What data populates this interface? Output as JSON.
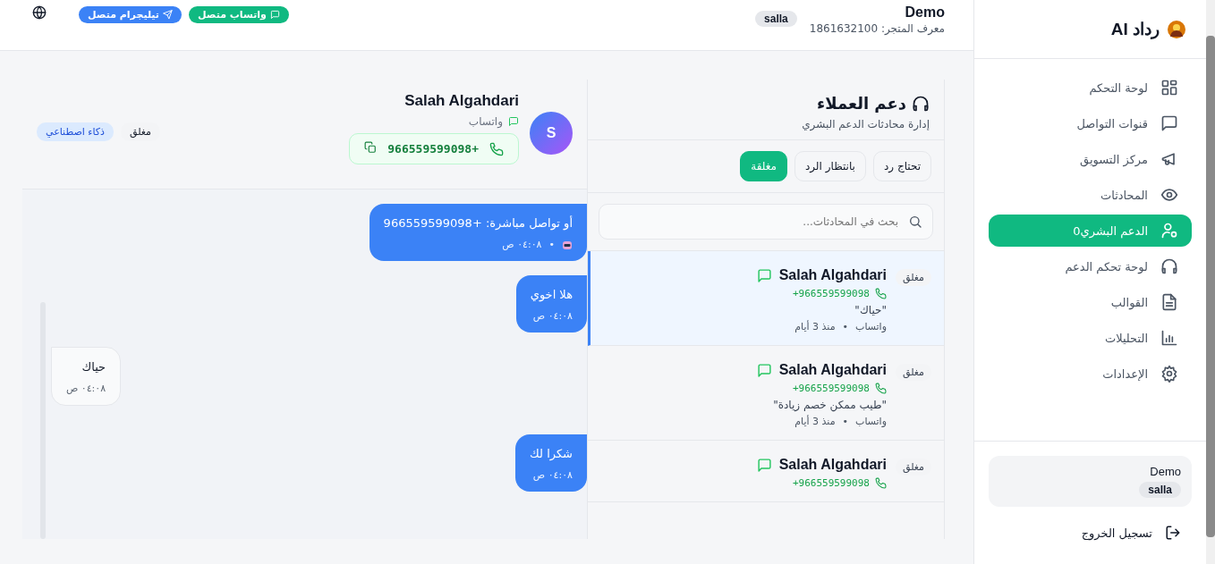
{
  "sidebar": {
    "brand": "رداد AI",
    "items": [
      {
        "label": "لوحة التحكم",
        "selected": false
      },
      {
        "label": "قنوات التواصل",
        "selected": false
      },
      {
        "label": "مركز التسويق",
        "selected": false
      },
      {
        "label": "المحادثات",
        "selected": false
      },
      {
        "label": "الدعم البشري0",
        "selected": true
      },
      {
        "label": "لوحة تحكم الدعم",
        "selected": false
      },
      {
        "label": "القوالب",
        "selected": false
      },
      {
        "label": "التحليلات",
        "selected": false
      },
      {
        "label": "الإعدادات",
        "selected": false
      }
    ],
    "store_card": {
      "name": "Demo",
      "platform": "salla"
    },
    "logout": "تسجيل الخروج"
  },
  "header": {
    "store_name": "Demo",
    "store_id": "معرف المتجر: 1861632100",
    "platform": "salla",
    "connections": [
      {
        "label": "واتساب متصل",
        "color": "#10b981"
      },
      {
        "label": "تيليجرام متصل",
        "color": "#3b82f6"
      }
    ]
  },
  "support": {
    "title": "دعم العملاء",
    "subtitle": "إدارة محادثات الدعم البشري",
    "filters": [
      {
        "label": "تحتاج رد",
        "selected": false
      },
      {
        "label": "بانتظار الرد",
        "selected": false
      },
      {
        "label": "مغلقة",
        "selected": true
      }
    ],
    "search": {
      "placeholder": "بحث في المحادثات..."
    },
    "conversations": [
      {
        "status": "مغلق",
        "name": "Salah Algahdari",
        "phone": "+966559599098",
        "preview": "\"حياك\"",
        "channel": "واتساب",
        "separator": "•",
        "time": "منذ 3 أيام",
        "selected": true
      },
      {
        "status": "مغلق",
        "name": "Salah Algahdari",
        "phone": "+966559599098",
        "preview": "\"طيب ممكن خصم زيادة\"",
        "channel": "واتساب",
        "separator": "•",
        "time": "منذ 3 أيام",
        "selected": false
      },
      {
        "status": "مغلق",
        "name": "Salah Algahdari",
        "phone": "+966559599098",
        "selected": false
      }
    ]
  },
  "chat": {
    "avatar": "S",
    "name": "Salah Algahdari",
    "channel": "واتساب",
    "phone": "+966559599098",
    "status": "مغلق",
    "mode": "ذكاء اصطناعي",
    "messages": [
      {
        "kind": "outgoing",
        "text": "أو تواصل مباشرة: +966559599098",
        "time": "٠٤:٠٨ ص",
        "bot": true,
        "separator": "•"
      },
      {
        "kind": "outgoing",
        "text": "هلا اخوي",
        "time": "٠٤:٠٨ ص",
        "bot": false
      },
      {
        "kind": "incoming",
        "text": "حياك",
        "time": "٠٤:٠٨ ص",
        "bot": false
      },
      {
        "kind": "outgoing",
        "text": "شكرا لك",
        "time": "٠٤:٠٨ ص",
        "bot": false
      }
    ]
  }
}
